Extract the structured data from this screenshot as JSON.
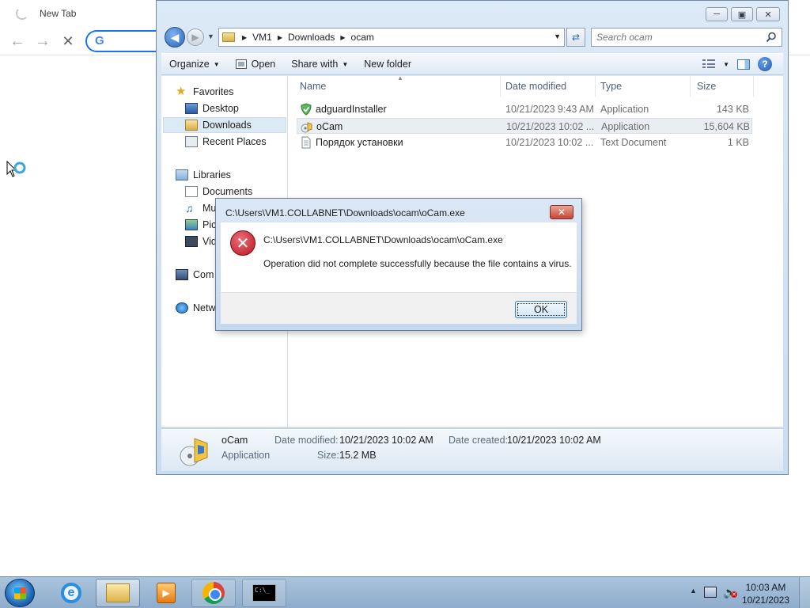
{
  "chrome": {
    "tab_title": "New Tab",
    "back_icon": "arrow-left-icon",
    "forward_icon": "arrow-right-icon",
    "stop_icon": "close-icon",
    "omnibox_logo": "G"
  },
  "explorer": {
    "address": {
      "crumbs": [
        "VM1",
        "Downloads",
        "ocam"
      ]
    },
    "search_placeholder": "Search ocam",
    "toolbar": {
      "organize": "Organize",
      "open": "Open",
      "share_with": "Share with",
      "new_folder": "New folder"
    },
    "nav": {
      "favorites": "Favorites",
      "desktop": "Desktop",
      "downloads": "Downloads",
      "recent_places": "Recent Places",
      "libraries": "Libraries",
      "documents": "Documents",
      "music": "Mu",
      "pictures": "Pic",
      "videos": "Vid",
      "computer": "Com",
      "network": "Netw"
    },
    "columns": {
      "name": "Name",
      "date_modified": "Date modified",
      "type": "Type",
      "size": "Size"
    },
    "files": [
      {
        "name": "adguardInstaller",
        "date": "10/21/2023 9:43 AM",
        "type": "Application",
        "size": "143 KB"
      },
      {
        "name": "oCam",
        "date": "10/21/2023 10:02 ...",
        "type": "Application",
        "size": "15,604 KB"
      },
      {
        "name": "Порядок установки",
        "date": "10/21/2023 10:02 ...",
        "type": "Text Document",
        "size": "1 KB"
      }
    ],
    "details": {
      "name": "oCam",
      "type": "Application",
      "date_modified_label": "Date modified:",
      "date_modified": "10/21/2023 10:02 AM",
      "date_created_label": "Date created:",
      "date_created": "10/21/2023 10:02 AM",
      "size_label": "Size:",
      "size": "15.2 MB"
    }
  },
  "dialog": {
    "title": "C:\\Users\\VM1.COLLABNET\\Downloads\\ocam\\oCam.exe",
    "path": "C:\\Users\\VM1.COLLABNET\\Downloads\\ocam\\oCam.exe",
    "message": "Operation did not complete successfully because the file contains a virus.",
    "ok_label": "OK",
    "icon": "error-icon"
  },
  "taskbar": {
    "time": "10:03 AM",
    "date": "10/21/2023",
    "cmd_label": "C:\\_"
  }
}
